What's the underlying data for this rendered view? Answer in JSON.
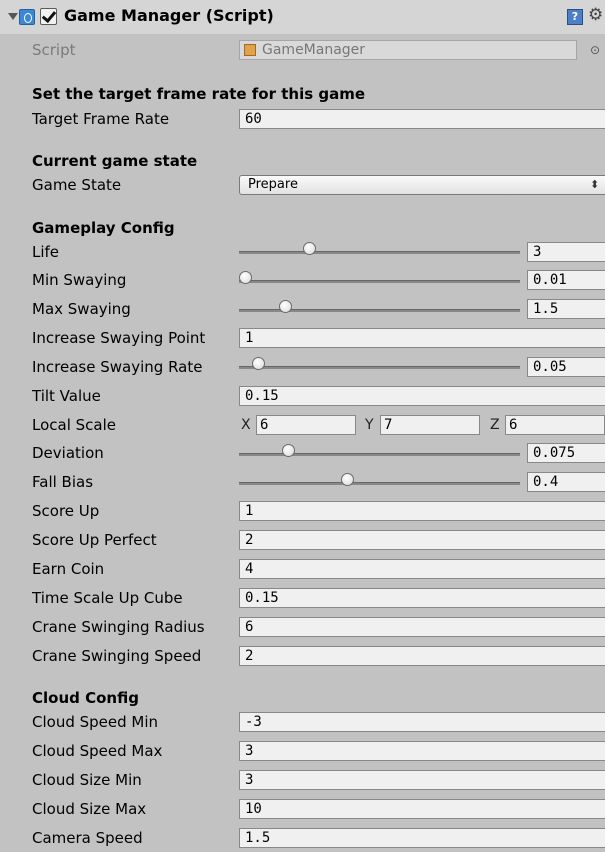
{
  "header": {
    "title": "Game Manager (Script)",
    "enabled": true,
    "help_glyph": "?",
    "gear_glyph": "⚙",
    "icons": [
      "script-icon",
      "help-icon",
      "gear-icon"
    ]
  },
  "script_field": {
    "label": "Script",
    "value": "GameManager",
    "picker_glyph": "⊙"
  },
  "sections": {
    "frame_rate": "Set the target frame rate for this game",
    "state": "Current game state",
    "gameplay": "Gameplay Config",
    "cloud": "Cloud Config"
  },
  "fields": {
    "target_frame_rate": {
      "label": "Target Frame Rate",
      "value": "60"
    },
    "game_state": {
      "label": "Game State",
      "value": "Prepare",
      "arrow": "⬍"
    },
    "life": {
      "label": "Life",
      "value": "3",
      "slider_fraction": 0.24
    },
    "min_swaying": {
      "label": "Min Swaying",
      "value": "0.01",
      "slider_fraction": 0.0
    },
    "max_swaying": {
      "label": "Max Swaying",
      "value": "1.5",
      "slider_fraction": 0.15
    },
    "increase_swaying_point": {
      "label": "Increase Swaying Point",
      "value": "1"
    },
    "increase_swaying_rate": {
      "label": "Increase Swaying Rate",
      "value": "0.05",
      "slider_fraction": 0.05
    },
    "tilt_value": {
      "label": "Tilt Value",
      "value": "0.15"
    },
    "local_scale": {
      "label": "Local Scale",
      "x_label": "X",
      "x": "6",
      "y_label": "Y",
      "y": "7",
      "z_label": "Z",
      "z": "6"
    },
    "deviation": {
      "label": "Deviation",
      "value": "0.075",
      "slider_fraction": 0.16
    },
    "fall_bias": {
      "label": "Fall Bias",
      "value": "0.4",
      "slider_fraction": 0.38
    },
    "score_up": {
      "label": "Score Up",
      "value": "1"
    },
    "score_up_perfect": {
      "label": "Score Up Perfect",
      "value": "2"
    },
    "earn_coin": {
      "label": "Earn Coin",
      "value": "4"
    },
    "time_scale_up_cube": {
      "label": "Time Scale Up Cube",
      "value": "0.15"
    },
    "crane_swinging_radius": {
      "label": "Crane Swinging Radius",
      "value": "6"
    },
    "crane_swinging_speed": {
      "label": "Crane Swinging Speed",
      "value": "2"
    },
    "cloud_speed_min": {
      "label": "Cloud Speed Min",
      "value": "-3"
    },
    "cloud_speed_max": {
      "label": "Cloud Speed Max",
      "value": "3"
    },
    "cloud_size_min": {
      "label": "Cloud Size Min",
      "value": "3"
    },
    "cloud_size_max": {
      "label": "Cloud Size Max",
      "value": "10"
    },
    "camera_speed": {
      "label": "Camera Speed",
      "value": "1.5"
    }
  }
}
